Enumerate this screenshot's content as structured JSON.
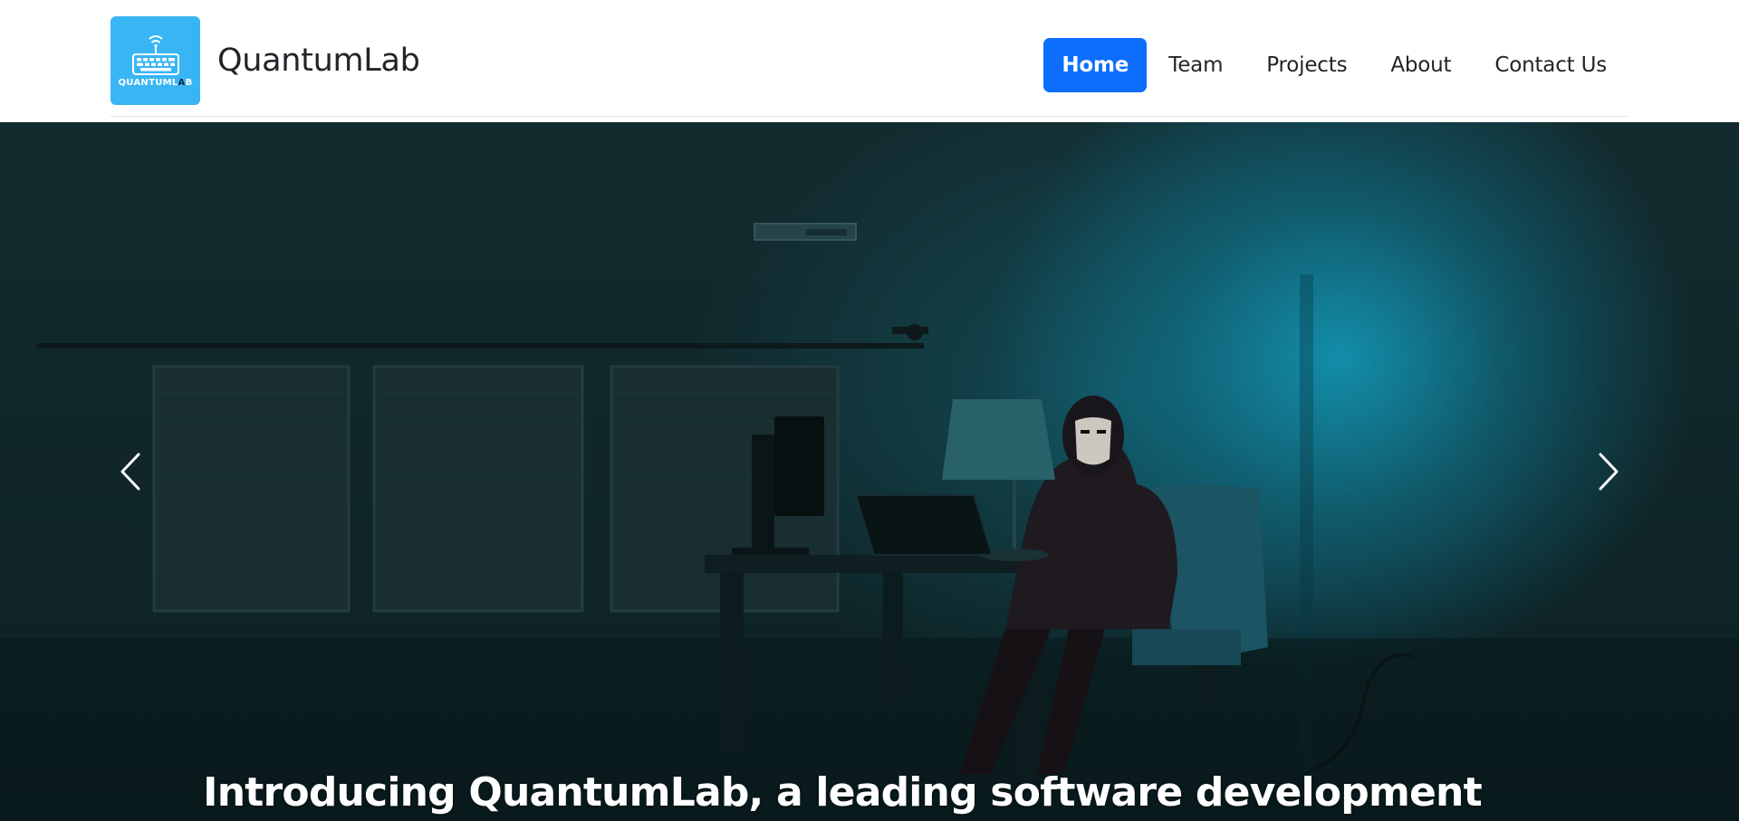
{
  "brand": {
    "name": "QuantumLab",
    "logo_text_main": "QUANTUML",
    "logo_text_a": "A",
    "logo_text_end": "B",
    "logo_color": "#3ab5f4"
  },
  "nav": {
    "items": [
      {
        "label": "Home",
        "active": true
      },
      {
        "label": "Team",
        "active": false
      },
      {
        "label": "Projects",
        "active": false
      },
      {
        "label": "About",
        "active": false
      },
      {
        "label": "Contact Us",
        "active": false
      }
    ],
    "active_color": "#0d6efd"
  },
  "carousel": {
    "caption": "Introducing QuantumLab, a leading software development",
    "prev_icon": "chevron-left-icon",
    "next_icon": "chevron-right-icon",
    "slide_description_icon": "hooded-figure-at-desk"
  }
}
